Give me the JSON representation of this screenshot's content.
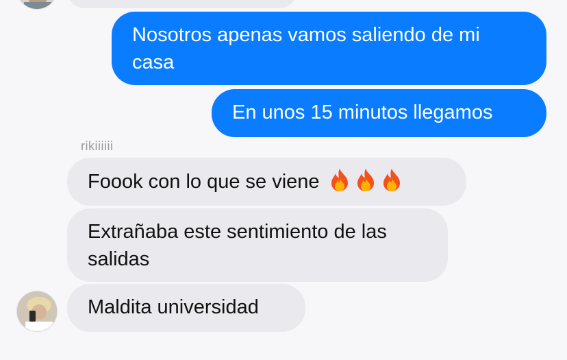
{
  "conversation": {
    "top_partial_message": {
      "text": ""
    },
    "outgoing": [
      {
        "text": "Nosotros apenas vamos saliendo de mi casa"
      },
      {
        "text": "En unos 15 minutos llegamos"
      }
    ],
    "sender_name": "rikiiiiii",
    "incoming": [
      {
        "text": "Foook con lo que se viene",
        "emoji": "fire-icon",
        "emoji_count": 3
      },
      {
        "text": "Extrañaba este sentimiento de las salidas"
      },
      {
        "text": "Maldita universidad"
      }
    ]
  },
  "colors": {
    "outgoing_bubble": "#0a7cff",
    "incoming_bubble": "#e9e9ee",
    "background": "#f7f7f9",
    "sender_label": "#9a9aa0"
  }
}
